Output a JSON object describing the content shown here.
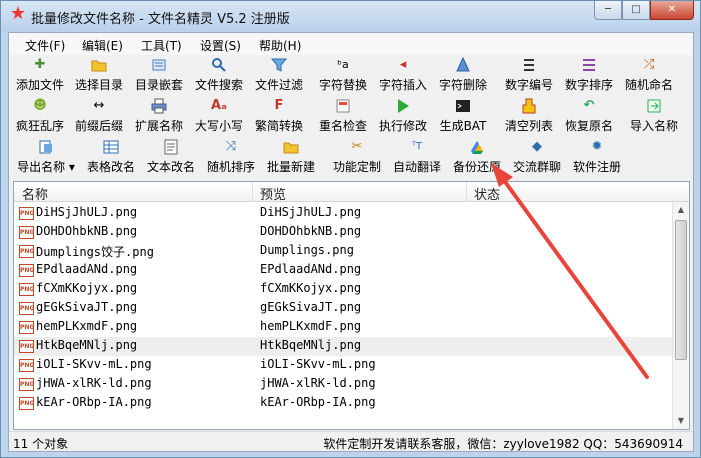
{
  "window": {
    "title": "批量修改文件名称 - 文件名精灵 V5.2 注册版",
    "minimize_glyph": "─",
    "maximize_glyph": "□",
    "close_glyph": "✕"
  },
  "menu": [
    {
      "label": "文件(F)"
    },
    {
      "label": "编辑(E)"
    },
    {
      "label": "工具(T)"
    },
    {
      "label": "设置(S)"
    },
    {
      "label": "帮助(H)"
    }
  ],
  "toolbar": {
    "row1": [
      {
        "label": "添加文件",
        "icon": "add-file-icon"
      },
      {
        "label": "选择目录",
        "icon": "folder-icon"
      },
      {
        "label": "目录嵌套",
        "icon": "folder-tree-icon"
      },
      {
        "label": "文件搜索",
        "icon": "search-icon"
      },
      {
        "label": "文件过滤",
        "icon": "filter-icon"
      },
      {
        "label": "字符替换",
        "icon": "replace-icon"
      },
      {
        "label": "字符插入",
        "icon": "insert-icon"
      },
      {
        "label": "字符删除",
        "icon": "delete-char-icon"
      },
      {
        "label": "数字编号",
        "icon": "number-list-icon"
      },
      {
        "label": "数字排序",
        "icon": "sort-icon"
      },
      {
        "label": "随机命名",
        "icon": "shuffle-icon"
      }
    ],
    "row2": [
      {
        "label": "疯狂乱序",
        "icon": "smiley-icon"
      },
      {
        "label": "前缀后缀",
        "icon": "arrows-icon"
      },
      {
        "label": "扩展名称",
        "icon": "printer-icon"
      },
      {
        "label": "大写小写",
        "icon": "case-icon"
      },
      {
        "label": "繁简转换",
        "icon": "font-convert-icon"
      },
      {
        "label": "重名检查",
        "icon": "check-icon"
      },
      {
        "label": "执行修改",
        "icon": "play-icon"
      },
      {
        "label": "生成BAT",
        "icon": "terminal-icon"
      },
      {
        "label": "清空列表",
        "icon": "clear-icon"
      },
      {
        "label": "恢复原名",
        "icon": "undo-icon"
      },
      {
        "label": "导入名称",
        "icon": "import-icon"
      }
    ],
    "row3": [
      {
        "label": "导出名称",
        "icon": "export-icon"
      },
      {
        "label": "表格改名",
        "icon": "table-icon"
      },
      {
        "label": "文本改名",
        "icon": "text-icon"
      },
      {
        "label": "随机排序",
        "icon": "random-sort-icon"
      },
      {
        "label": "批量新建",
        "icon": "new-folder-icon"
      },
      {
        "label": "功能定制",
        "icon": "tools-icon"
      },
      {
        "label": "自动翻译",
        "icon": "translate-icon"
      },
      {
        "label": "备份还原",
        "icon": "drive-icon"
      },
      {
        "label": "交流群聊",
        "icon": "chat-icon"
      },
      {
        "label": "软件注册",
        "icon": "register-icon"
      }
    ],
    "export_dropdown_glyph": "▾"
  },
  "list": {
    "columns": [
      "名称",
      "预览",
      "状态"
    ],
    "file_icon_text": "PNG",
    "rows": [
      {
        "name": "DiHSjJhULJ.png",
        "preview": "DiHSjJhULJ.png",
        "status": ""
      },
      {
        "name": "DOHDOhbkNB.png",
        "preview": "DOHDOhbkNB.png",
        "status": ""
      },
      {
        "name": "Dumplings饺子.png",
        "preview": "Dumplings.png",
        "status": ""
      },
      {
        "name": "EPdlaadANd.png",
        "preview": "EPdlaadANd.png",
        "status": ""
      },
      {
        "name": "fCXmKKojyx.png",
        "preview": "fCXmKKojyx.png",
        "status": ""
      },
      {
        "name": "gEGkSivaJT.png",
        "preview": "gEGkSivaJT.png",
        "status": ""
      },
      {
        "name": "hemPLKxmdF.png",
        "preview": "hemPLKxmdF.png",
        "status": ""
      },
      {
        "name": "HtkBqeMNlj.png",
        "preview": "HtkBqeMNlj.png",
        "status": ""
      },
      {
        "name": "iOLI-SKvv-mL.png",
        "preview": "iOLI-SKvv-mL.png",
        "status": ""
      },
      {
        "name": "jHWA-xlRK-ld.png",
        "preview": "jHWA-xlRK-ld.png",
        "status": ""
      },
      {
        "name": "kEAr-ORbp-IA.png",
        "preview": "kEAr-ORbp-IA.png",
        "status": ""
      }
    ]
  },
  "status": {
    "count": "11 个对象",
    "contact": "软件定制开发请联系客服，微信：zyylove1982  QQ：543690914"
  },
  "colors": {
    "annotation_arrow": "#e8453a",
    "title_gradient_top": "#d8e6f5",
    "title_gradient_bottom": "#b9d0ea"
  }
}
